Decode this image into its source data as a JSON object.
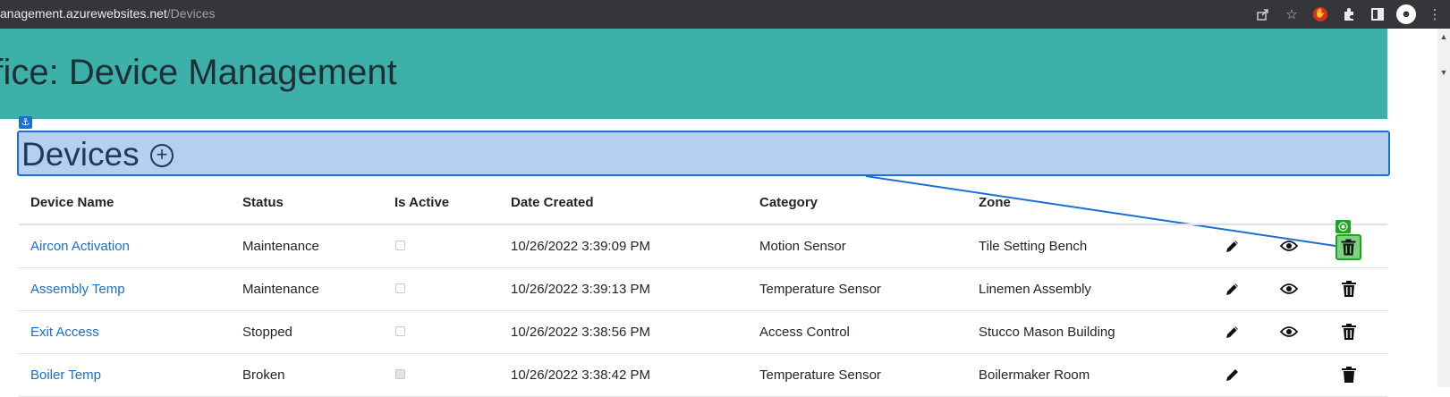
{
  "browser": {
    "url_host": "anagement.azurewebsites.net",
    "url_path": "/Devices",
    "icons": [
      "share-icon",
      "bookmark-star-icon",
      "adblock-extension-icon",
      "extensions-puzzle-icon",
      "side-panel-icon",
      "profile-avatar-icon",
      "menu-kebab-icon"
    ]
  },
  "app": {
    "title": "ffice: Device Management"
  },
  "section": {
    "title": "Devices",
    "add_label": "+"
  },
  "table": {
    "headers": [
      "Device Name",
      "Status",
      "Is Active",
      "Date Created",
      "Category",
      "Zone"
    ],
    "rows": [
      {
        "name": "Aircon Activation",
        "status": "Maintenance",
        "active": false,
        "date": "10/26/2022 3:39:09 PM",
        "category": "Motion Sensor",
        "zone": "Tile Setting Bench"
      },
      {
        "name": "Assembly Temp",
        "status": "Maintenance",
        "active": false,
        "date": "10/26/2022 3:39:13 PM",
        "category": "Temperature Sensor",
        "zone": "Linemen Assembly"
      },
      {
        "name": "Exit Access",
        "status": "Stopped",
        "active": false,
        "date": "10/26/2022 3:38:56 PM",
        "category": "Access Control",
        "zone": "Stucco Mason Building"
      },
      {
        "name": "Boiler Temp",
        "status": "Broken",
        "active": true,
        "date": "10/26/2022 3:38:42 PM",
        "category": "Temperature Sensor",
        "zone": "Boilermaker Room"
      }
    ]
  },
  "colors": {
    "header_bg": "#3cb0a9",
    "selection_bg": "#b3d0f3",
    "selection_border": "#1a6fd6",
    "link": "#1a6fc9",
    "target_highlight": "#1ea51e"
  }
}
